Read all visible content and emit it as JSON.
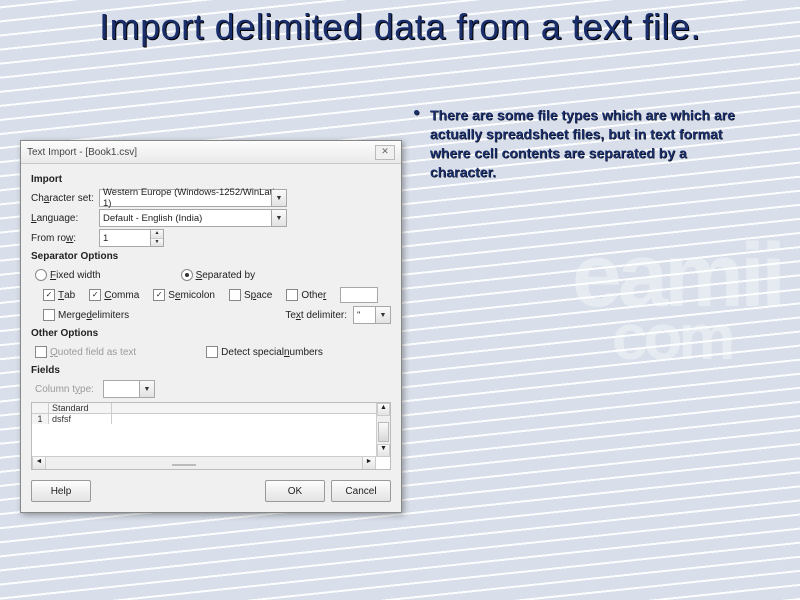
{
  "slide": {
    "title": "Import delimited data from a text file.",
    "bullet_text": "There are some file types which are which are actually spreadsheet files, but in text format where cell contents are separated by a character."
  },
  "watermark": {
    "line1": "eamii",
    "line2": "com"
  },
  "dialog": {
    "title": "Text Import - [Book1.csv]",
    "close": "✕",
    "import_section": "Import",
    "charset_label": "Character set:",
    "charset_value": "Western Europe (Windows-1252/WinLatin 1)",
    "language_label": "Language:",
    "language_value": "Default - English (India)",
    "fromrow_label": "From row:",
    "fromrow_value": "1",
    "sep_section": "Separator Options",
    "fixed_width": "Fixed width",
    "separated_by": "Separated by",
    "tab": "Tab",
    "comma": "Comma",
    "semicolon": "Semicolon",
    "space": "Space",
    "other": "Other",
    "merge": "Merge delimiters",
    "text_delim_label": "Text delimiter:",
    "text_delim_value": "\"",
    "other_section": "Other Options",
    "quoted_field": "Quoted field as text",
    "detect_numbers": "Detect special numbers",
    "fields_section": "Fields",
    "coltype_label": "Column type:",
    "preview_colhead": "Standard",
    "preview_rownum": "1",
    "preview_cell": "dsfsf",
    "help": "Help",
    "ok": "OK",
    "cancel": "Cancel"
  }
}
